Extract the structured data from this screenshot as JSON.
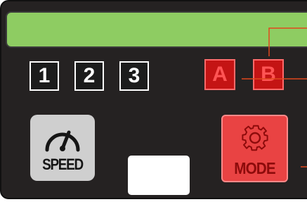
{
  "number_buttons": [
    {
      "label": "1"
    },
    {
      "label": "2"
    },
    {
      "label": "3"
    }
  ],
  "channel_buttons": [
    {
      "label": "A"
    },
    {
      "label": "B"
    }
  ],
  "speed_button": {
    "label": "SPEED",
    "icon": "speedometer-icon"
  },
  "mode_button": {
    "label": "MODE",
    "icon": "gear-icon"
  },
  "colors": {
    "panel": "#252222",
    "display": "#8ecc62",
    "channel_button": "#c41414",
    "mode_button": "#e94343",
    "speed_button": "#cfcfcf",
    "leader_lines": "#e0481c"
  }
}
